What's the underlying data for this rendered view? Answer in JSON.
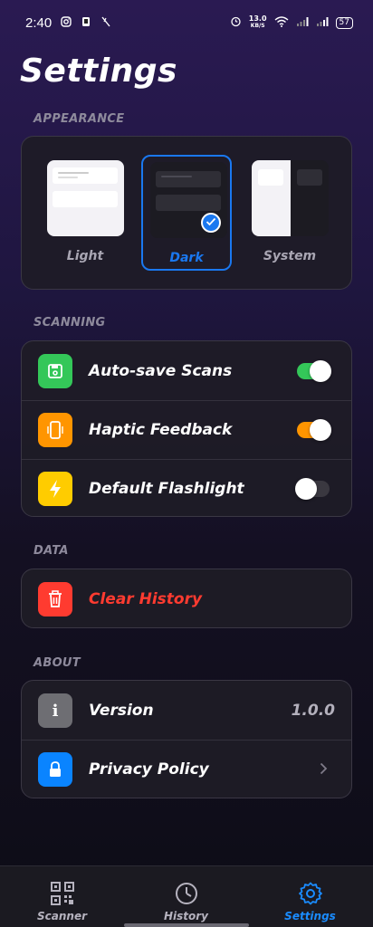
{
  "status_bar": {
    "time": "2:40",
    "net_speed_value": "13.0",
    "net_speed_unit": "KB/S",
    "battery": "57"
  },
  "page": {
    "title": "Settings"
  },
  "appearance": {
    "section_label": "APPEARANCE",
    "options": [
      {
        "label": "Light",
        "selected": false
      },
      {
        "label": "Dark",
        "selected": true
      },
      {
        "label": "System",
        "selected": false
      }
    ]
  },
  "scanning": {
    "section_label": "SCANNING",
    "items": [
      {
        "label": "Auto-save Scans",
        "icon": "save-icon",
        "icon_color": "#34c759",
        "toggle_on": true,
        "toggle_color": "#34c759"
      },
      {
        "label": "Haptic Feedback",
        "icon": "phone-vibrate-icon",
        "icon_color": "#ff9500",
        "toggle_on": true,
        "toggle_color": "#ff9500"
      },
      {
        "label": "Default Flashlight",
        "icon": "lightning-icon",
        "icon_color": "#ffcc00",
        "toggle_on": false
      }
    ]
  },
  "data_section": {
    "section_label": "DATA",
    "clear_history": {
      "label": "Clear History",
      "icon": "trash-icon",
      "color": "#ff3b30"
    }
  },
  "about": {
    "section_label": "ABOUT",
    "version_label": "Version",
    "version_value": "1.0.0",
    "privacy_label": "Privacy Policy",
    "info_icon_color": "#8e8e93",
    "lock_icon_color": "#0a84ff"
  },
  "nav": {
    "items": [
      {
        "label": "Scanner",
        "icon": "qr-code-icon",
        "active": false
      },
      {
        "label": "History",
        "icon": "clock-icon",
        "active": false
      },
      {
        "label": "Settings",
        "icon": "gear-icon",
        "active": true
      }
    ],
    "accent": "#1a8cff"
  }
}
